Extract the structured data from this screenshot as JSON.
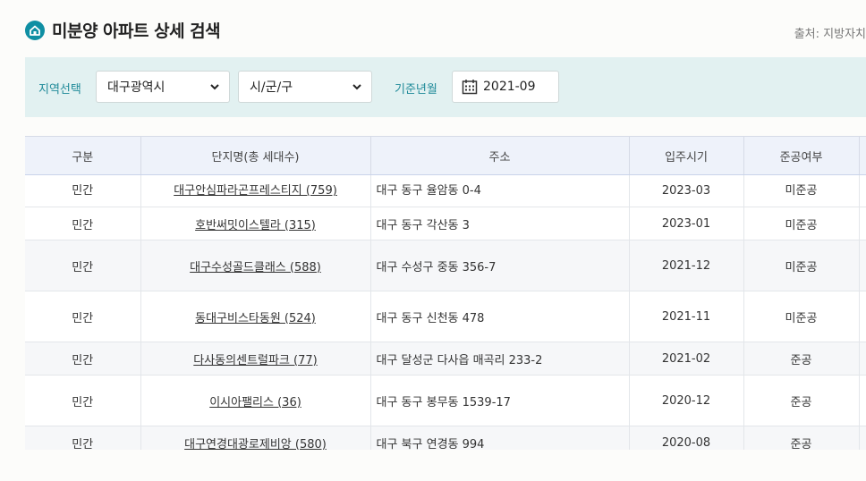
{
  "header": {
    "title": "미분양 아파트 상세 검색",
    "source": "출처: 지방자치"
  },
  "filters": {
    "region_label": "지역선택",
    "region_value": "대구광역시",
    "district_value": "시/군/구",
    "date_label": "기준년월",
    "date_value": "2021-09"
  },
  "table": {
    "columns": [
      "구분",
      "단지명(총 세대수)",
      "주소",
      "입주시기",
      "준공여부"
    ],
    "rows": [
      {
        "type": "민간",
        "name": "대구안심파라곤프레스티지 (759)",
        "address": "대구 동구 율암동 0-4",
        "move_in": "2023-03",
        "status": "미준공"
      },
      {
        "type": "민간",
        "name": "호반써밋이스텔라 (315)",
        "address": "대구 동구 각산동 3",
        "move_in": "2023-01",
        "status": "미준공"
      },
      {
        "type": "민간",
        "name": "대구수성골드클래스 (588)",
        "address": "대구 수성구 중동 356-7",
        "move_in": "2021-12",
        "status": "미준공"
      },
      {
        "type": "민간",
        "name": "동대구비스타동원 (524)",
        "address": "대구 동구 신천동 478",
        "move_in": "2021-11",
        "status": "미준공"
      },
      {
        "type": "민간",
        "name": "다사동의센트럴파크 (77)",
        "address": "대구 달성군 다사읍 매곡리 233-2",
        "move_in": "2021-02",
        "status": "준공"
      },
      {
        "type": "민간",
        "name": "이시아팰리스 (36)",
        "address": "대구 동구 봉무동 1539-17",
        "move_in": "2020-12",
        "status": "준공"
      },
      {
        "type": "민간",
        "name": "대구연경대광로제비앙 (580)",
        "address": "대구 북구 연경동 994",
        "move_in": "2020-08",
        "status": "준공"
      }
    ]
  },
  "colors": {
    "accent": "#0f8fa3",
    "filter_bg": "#e2f1f1",
    "header_bg": "#eef2fa"
  }
}
